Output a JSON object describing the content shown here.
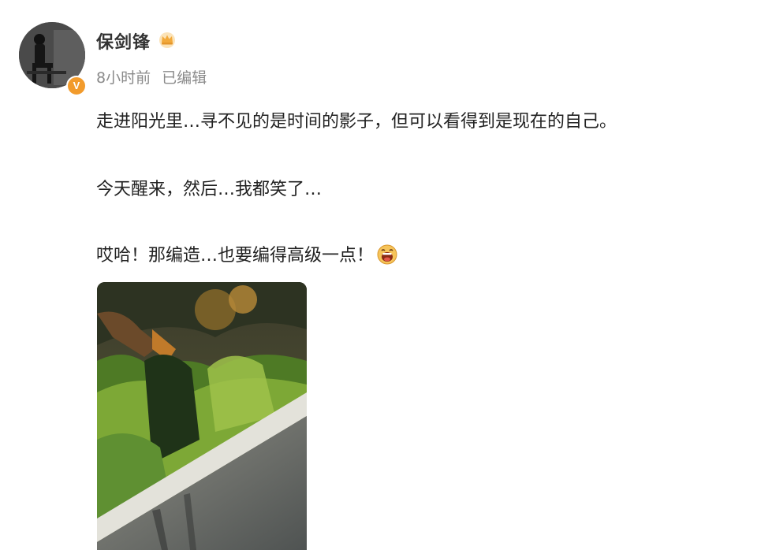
{
  "post": {
    "author": {
      "name": "保剑锋",
      "verified_badge": "V",
      "avatar_icon": "user-avatar",
      "crown_icon": "crown-icon"
    },
    "meta": {
      "time": "8小时前",
      "edited": "已编辑"
    },
    "content": {
      "line1": "走进阳光里…寻不见的是时间的影子，但可以看得到是现在的自己。",
      "line2": "今天醒来，然后…我都笑了…",
      "line3": "哎哈！那编造…也要编得高级一点！",
      "emoji": "laughing-emoji"
    },
    "image": {
      "alt": "shadow-on-hedge-photo"
    }
  },
  "colors": {
    "verified": "#f29b2c",
    "meta_text": "#8a8a8a",
    "body_text": "#222222"
  }
}
